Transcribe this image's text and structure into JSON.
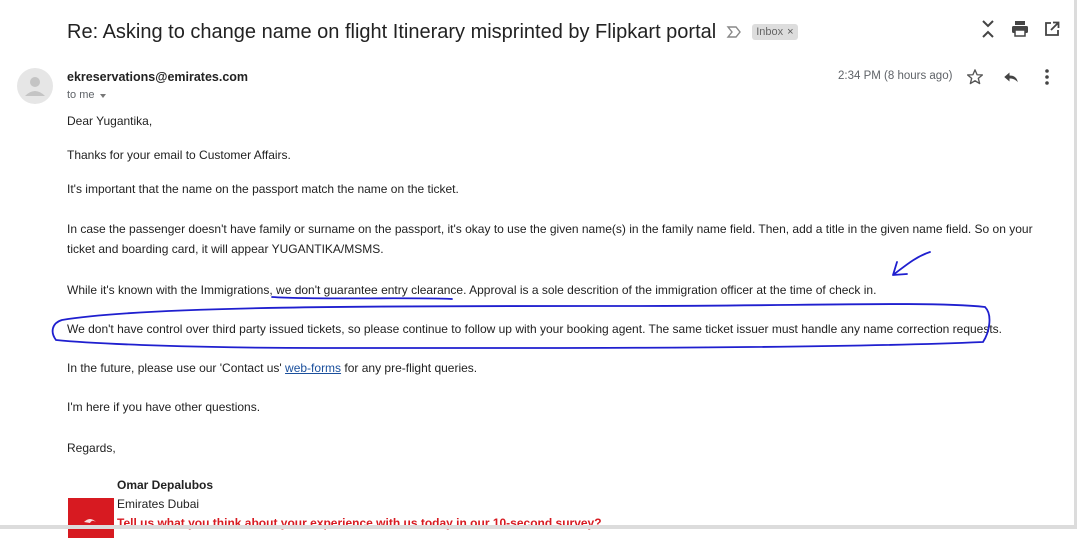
{
  "email": {
    "subject": "Re: Asking to change name on flight Itinerary misprinted by Flipkart portal",
    "label_chip": "Inbox",
    "label_remove": "×",
    "sender_email": "ekreservations@emirates.com",
    "recipient_text": "to me",
    "time": "2:34 PM (8 hours ago)",
    "body": {
      "greeting": "Dear Yugantika,",
      "p1": "Thanks for your email to Customer Affairs.",
      "p2": "It's important that the name on the passport match the name on the ticket.",
      "p3": "In case the passenger doesn't have family or surname on the passport, it's okay to use the given name(s) in the family name field. Then, add a title in the given name field. So on your ticket and boarding card, it will appear YUGANTIKA/MSMS.",
      "p4_prefix": "While it's known with the Immigrations, ",
      "p4_highlight": "we don't guarantee entry clearance.",
      "p4_suffix": " Approval is a sole descrition of the immigration officer at the time of check in.",
      "p5": "We don't have control over third party issued tickets, so please continue to follow up with your booking agent. The same ticket issuer must handle any name correction requests.",
      "p6_prefix": "In the future, please use our 'Contact us' ",
      "p6_link": "web-forms",
      "p6_suffix": " for any pre-flight queries.",
      "p7": "I'm here if you have other questions.",
      "closing": "Regards,"
    },
    "signature": {
      "name": "Omar Depalubos",
      "company": "Emirates Dubai",
      "survey_text": "Tell us what you think about your experience with us today in our 10-second survey?"
    }
  },
  "icons": {
    "label_arrow": "label-arrow-icon",
    "collapse": "collapse-icon",
    "print": "print-icon",
    "open_new": "open-in-new-window-icon",
    "star": "star-icon",
    "reply": "reply-icon",
    "more": "more-vertical-icon",
    "avatar": "person-avatar-icon"
  },
  "colors": {
    "annotation_ink": "#1f1fcf",
    "link": "#1a4f9c",
    "brand_red": "#d71a21"
  }
}
